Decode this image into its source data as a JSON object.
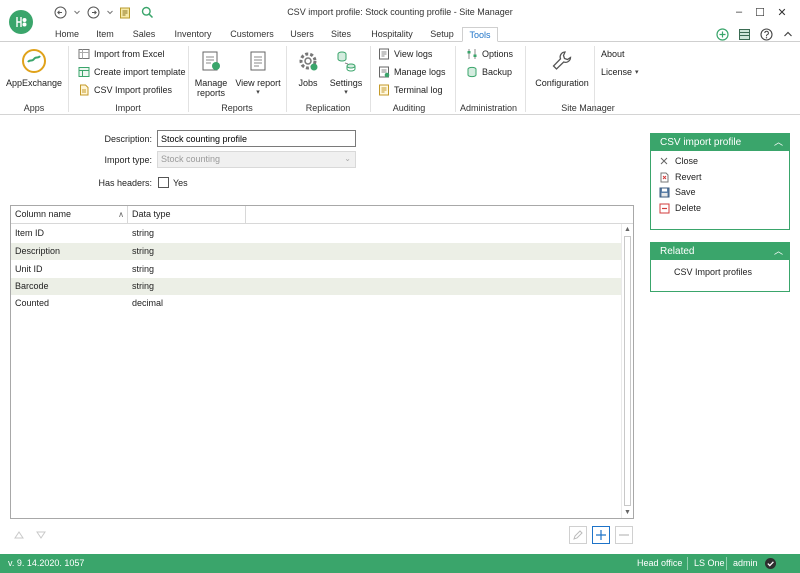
{
  "window": {
    "title": "CSV import profile: Stock counting profile - Site Manager",
    "minimize": "–",
    "maximize": "☐",
    "close": "✕"
  },
  "tabs": [
    "Home",
    "Item",
    "Sales",
    "Inventory",
    "Customers",
    "Users",
    "Sites",
    "Hospitality",
    "Setup",
    "Tools"
  ],
  "active_tab": "Tools",
  "ribbon": {
    "apps": {
      "label": "Apps",
      "appexchange": "AppExchange"
    },
    "import": {
      "label": "Import",
      "import_excel": "Import from Excel",
      "create_template": "Create import template",
      "csv_profiles": "CSV Import profiles"
    },
    "reports": {
      "label": "Reports",
      "manage_line1": "Manage",
      "manage_line2": "reports",
      "view_report": "View report"
    },
    "replication": {
      "label": "Replication",
      "jobs": "Jobs",
      "settings": "Settings"
    },
    "auditing": {
      "label": "Auditing",
      "view_logs": "View logs",
      "manage_logs": "Manage logs",
      "terminal_log": "Terminal log"
    },
    "administration": {
      "label": "Administration",
      "options": "Options",
      "backup": "Backup"
    },
    "site_manager": {
      "label": "Site Manager",
      "configuration": "Configuration",
      "about": "About",
      "license": "License"
    }
  },
  "form": {
    "description_label": "Description:",
    "description_value": "Stock counting profile",
    "import_type_label": "Import type:",
    "import_type_value": "Stock counting",
    "has_headers_label": "Has headers:",
    "has_headers_option": "Yes"
  },
  "grid": {
    "columns": [
      "Column name",
      "Data type"
    ],
    "rows": [
      {
        "name": "Item ID",
        "type": "string"
      },
      {
        "name": "Description",
        "type": "string"
      },
      {
        "name": "Unit ID",
        "type": "string"
      },
      {
        "name": "Barcode",
        "type": "string"
      },
      {
        "name": "Counted",
        "type": "decimal"
      }
    ]
  },
  "profile_panel": {
    "title": "CSV import profile",
    "items": [
      "Close",
      "Revert",
      "Save",
      "Delete"
    ]
  },
  "related_panel": {
    "title": "Related",
    "items": [
      "CSV Import profiles"
    ]
  },
  "statusbar": {
    "version": "v. 9. 14.2020. 1057",
    "store": "Head office",
    "db": "LS One",
    "user": "admin"
  },
  "colors": {
    "brand": "#3aa56b",
    "accent": "#1e73c8",
    "alt_row": "#ecefe6"
  }
}
